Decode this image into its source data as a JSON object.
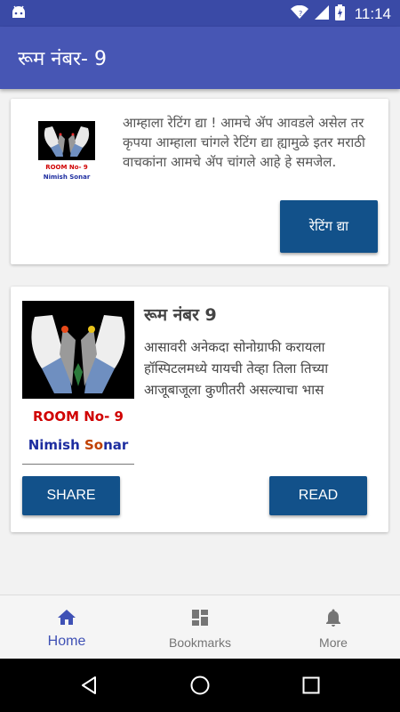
{
  "status_bar": {
    "time": "11:14"
  },
  "app_bar": {
    "title": "रूम नंबर- 9"
  },
  "rating_card": {
    "logo_line1": "ROOM No- 9",
    "logo_line2": "Nimish Sonar",
    "message": "आम्हाला रेटिंग द्या ! आमचे ॲप आवडले असेल तर कृपया आम्हाला चांगले रेटिंग द्या ह्यामुळे इतर मराठी वाचकांना आमचे ॲप चांगले आहे हे समजेल.",
    "button_label": "रेटिंग द्या"
  },
  "book_card": {
    "cover_line1": "ROOM No- 9",
    "cover_author_a": "Nimish ",
    "cover_author_b": "So",
    "cover_author_c": "nar",
    "title": "रूम नंबर 9",
    "description": "आसावरी अनेकदा सोनोग्राफी करायला हॉस्पिटलमध्ये यायची तेव्हा तिला तिच्या आजूबाजूला कुणीतरी असल्याचा भास",
    "share_label": "SHARE",
    "read_label": "READ"
  },
  "bottom_nav": {
    "items": [
      {
        "label": "Home",
        "icon": "home-icon",
        "active": true
      },
      {
        "label": "Bookmarks",
        "icon": "dashboard-icon",
        "active": false
      },
      {
        "label": "More",
        "icon": "bell-icon",
        "active": false
      }
    ]
  },
  "colors": {
    "app_bar": "#4756b4",
    "status_bar": "#3a4aa6",
    "button": "#12518a",
    "active_nav": "#3f51b5"
  }
}
